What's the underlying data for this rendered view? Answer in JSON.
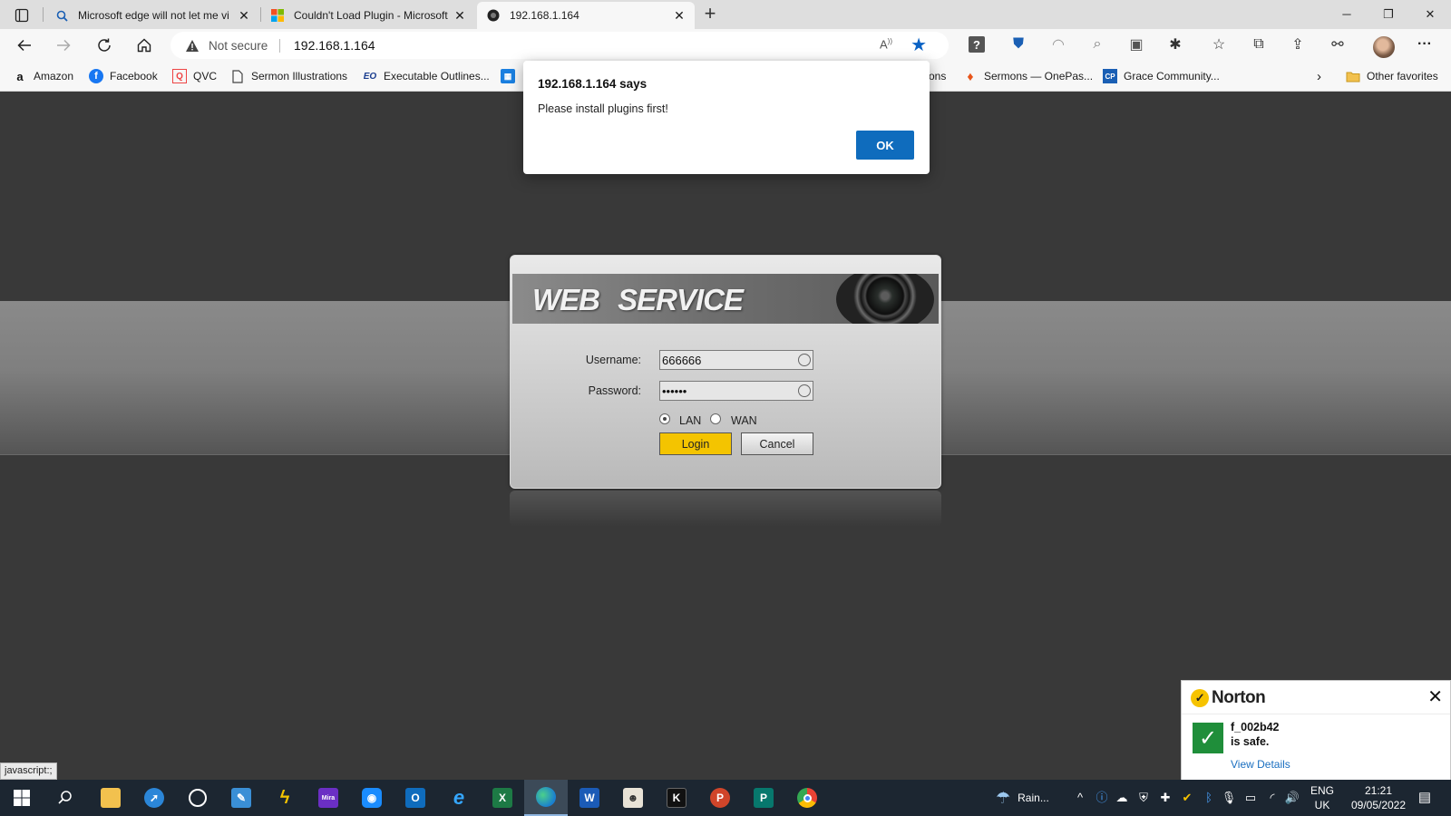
{
  "browser": {
    "tabs": [
      {
        "title": "Microsoft edge will not let me vi",
        "icon": "search-icon"
      },
      {
        "title": "Couldn't Load Plugin - Microsoft",
        "icon": "microsoft-logo-icon"
      },
      {
        "title": "192.168.1.164",
        "icon": "camera-icon",
        "active": true
      }
    ],
    "address": {
      "security_label": "Not secure",
      "url": "192.168.1.164"
    },
    "favorites": [
      {
        "label": "Amazon",
        "icon": "amazon-icon"
      },
      {
        "label": "Facebook",
        "icon": "facebook-icon"
      },
      {
        "label": "QVC",
        "icon": "qvc-icon"
      },
      {
        "label": "Sermon Illustrations",
        "icon": "page-icon"
      },
      {
        "label": "Executable Outlines...",
        "icon": "eo-icon"
      },
      {
        "label": "ons",
        "icon": ""
      },
      {
        "label": "Sermons — OnePas...",
        "icon": "flame-icon"
      },
      {
        "label": "Grace Community...",
        "icon": "cp-icon"
      },
      {
        "label": "Other favorites",
        "icon": "folder-icon"
      }
    ],
    "status_text": "javascript:;"
  },
  "dialog": {
    "title": "192.168.1.164 says",
    "message": "Please install plugins first!",
    "ok_label": "OK"
  },
  "login": {
    "banner": "WEB  SERVICE",
    "username_label": "Username:",
    "username_value": "666666",
    "password_label": "Password:",
    "password_value": "••••••",
    "lan_label": "LAN",
    "wan_label": "WAN",
    "selected_network": "LAN",
    "login_label": "Login",
    "cancel_label": "Cancel"
  },
  "norton": {
    "brand": "Norton",
    "file": "f_002b42",
    "status": "is safe.",
    "details_label": "View Details"
  },
  "taskbar": {
    "weather": "Rain...",
    "lang_top": "ENG",
    "lang_bottom": "UK",
    "time": "21:21",
    "date": "09/05/2022"
  },
  "colors": {
    "accent": "#0f6cbd",
    "login_button": "#f4c400",
    "taskbar": "#1c2631",
    "norton_check": "#1f8e3a"
  }
}
